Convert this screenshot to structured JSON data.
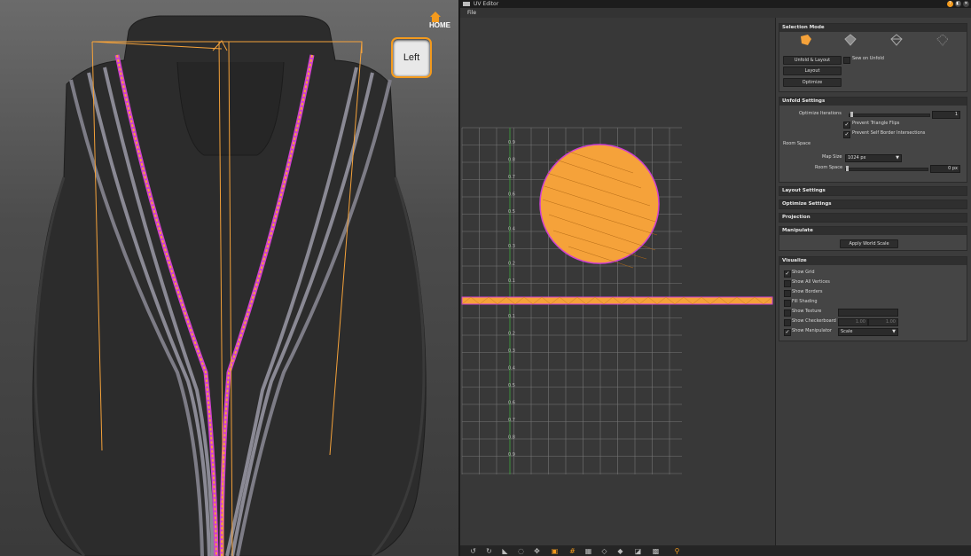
{
  "viewport": {
    "viewcube_label": "Left",
    "home_label": "HOME"
  },
  "uv_editor": {
    "title": "UV Editor",
    "menu_file": "File",
    "canvas": {
      "v_ticks": [
        "0.9",
        "0.8",
        "0.7",
        "0.6",
        "0.5",
        "0.4",
        "0.3",
        "0.2",
        "0.1"
      ],
      "neg_ticks": [
        "0.1",
        "0.2",
        "0.3",
        "0.4",
        "0.5",
        "0.6",
        "0.7",
        "0.8",
        "0.9"
      ]
    }
  },
  "panel": {
    "selection_mode": {
      "header": "Selection Mode",
      "icons": [
        "island-select-icon",
        "face-select-icon",
        "edge-select-icon",
        "vertex-select-icon"
      ],
      "unfold_layout": "Unfold & Layout",
      "sew_on_unfold": "Sew on Unfold",
      "sew_on_unfold_checked": false,
      "layout": "Layout",
      "optimize": "Optimize"
    },
    "unfold_settings": {
      "header": "Unfold Settings",
      "optimize_iterations_label": "Optimize Iterations",
      "optimize_iterations_value": "1",
      "prevent_triangle_flips": "Prevent Triangle Flips",
      "prevent_triangle_flips_checked": true,
      "prevent_self_border": "Prevent Self Border Intersections",
      "prevent_self_border_checked": true,
      "room_space_heading": "Room Space",
      "map_size_label": "Map Size",
      "map_size_value": "1024 px",
      "room_space_label": "Room Space",
      "room_space_value": "0 px"
    },
    "layout_settings": {
      "header": "Layout Settings"
    },
    "optimize_settings": {
      "header": "Optimize Settings"
    },
    "projection": {
      "header": "Projection"
    },
    "manipulate": {
      "header": "Manipulate",
      "apply_world_scale": "Apply World Scale"
    },
    "visualize": {
      "header": "Visualize",
      "show_grid": "Show Grid",
      "show_grid_checked": true,
      "show_all_vertices": "Show All Vertices",
      "show_borders": "Show Borders",
      "fill_shading": "Fill Shading",
      "show_texture": "Show Texture",
      "show_checkerboard": "Show Checkerboard",
      "checkerboard_value_a": "1.00",
      "checkerboard_value_b": "1.00",
      "show_manipulator": "Show Manipulator",
      "show_manipulator_checked": true,
      "manipulator_mode": "Scale"
    }
  },
  "colors": {
    "accent_orange": "#f5a23a",
    "uv_magenta": "#d040d0",
    "grid_line": "#7a7a7a"
  }
}
